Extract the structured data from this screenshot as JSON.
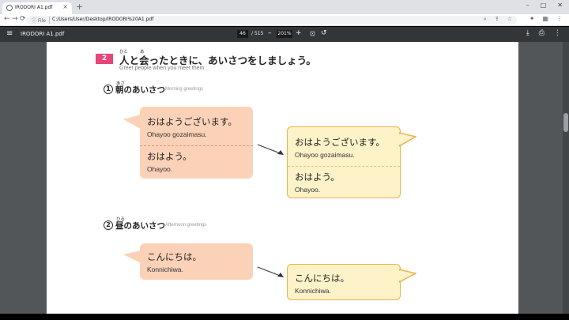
{
  "browser": {
    "tab_title": "IRODORI A1.pdf",
    "tab_close": "×",
    "new_tab": "+",
    "win_min": "–",
    "win_max": "□",
    "win_close": "✕",
    "back": "←",
    "forward": "→",
    "reload": "⟳",
    "file_label": "ⓘ File",
    "url": "C:/Users/User/Desktop/IRODORI%20A1.pdf",
    "zoom_icon": "⌕",
    "share_icon": "⇪",
    "star_icon": "☆",
    "ext_icon": "✦",
    "ext2_icon": "▦",
    "menu_icon": "⋮"
  },
  "pdf_toolbar": {
    "menu": "≡",
    "title": "IRODORI A1.pdf",
    "page_current": "46",
    "page_total": "/ 515",
    "zoom_minus": "–",
    "zoom": "201%",
    "zoom_plus": "+",
    "fit": "⊡",
    "rotate": "↺",
    "download": "⤓",
    "print": "⎙",
    "more": "⋮"
  },
  "page": {
    "section_number": "2",
    "title_ruby_1": "ひと",
    "title_ruby_2": "あ",
    "title": "人と会ったときに、あいさつをしましょう。",
    "subtitle": "Greet people when you meet them.",
    "subsection_1": {
      "number": "1",
      "ruby": "あさ",
      "title": "朝のあいさつ",
      "english": "Morning greetings",
      "left_bubble": {
        "jp_1": "おはようございます。",
        "ro_1": "Ohayoo gozaimasu.",
        "jp_2": "おはよう。",
        "ro_2": "Ohayoo."
      },
      "right_bubble": {
        "jp_1": "おはようございます。",
        "ro_1": "Ohayoo gozaimasu.",
        "jp_2": "おはよう。",
        "ro_2": "Ohayoo."
      }
    },
    "subsection_2": {
      "number": "2",
      "ruby": "ひる",
      "title": "昼のあいさつ",
      "english": "Afternoon greetings",
      "left_bubble": {
        "jp_1": "こんにちは。",
        "ro_1": "Konnichiwa."
      },
      "right_bubble": {
        "jp_1": "こんにちは。",
        "ro_1": "Konnichiwa."
      }
    }
  },
  "colors": {
    "section_badge": "#e8467b",
    "bubble_orange": "#fbd2b8",
    "bubble_yellow": "#fdf2c8",
    "bubble_yellow_border": "#e8b24c",
    "pdf_toolbar": "#323639",
    "viewer_background": "#525659"
  }
}
